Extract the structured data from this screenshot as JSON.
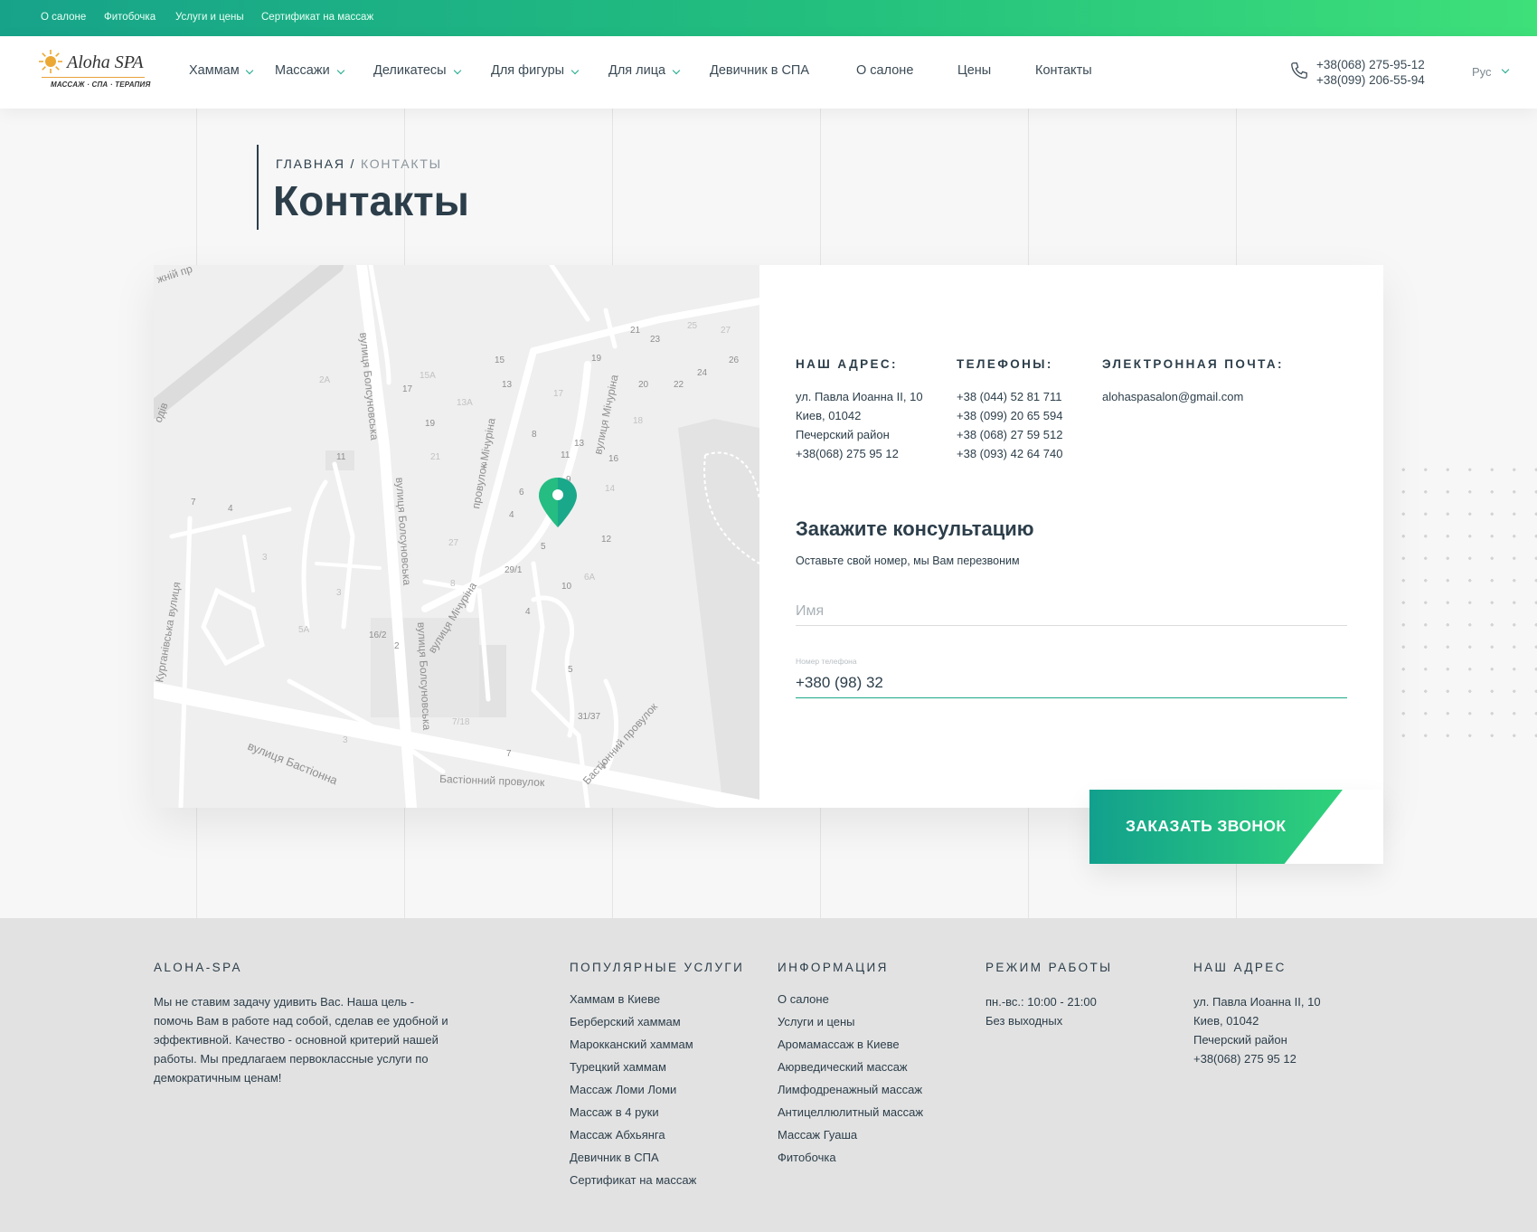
{
  "topbar": {
    "links": [
      "О салоне",
      "Фитобочка",
      "Услуги и цены",
      "Сертификат на массаж"
    ]
  },
  "brand": {
    "name": "Aloha SPA",
    "tagline": "МАССАЖ · СПА · ТЕРАПИЯ"
  },
  "nav": {
    "items": [
      {
        "label": "Хаммам",
        "dropdown": true
      },
      {
        "label": "Массажи",
        "dropdown": true
      },
      {
        "label": "Деликатесы",
        "dropdown": true
      },
      {
        "label": "Для фигуры",
        "dropdown": true
      },
      {
        "label": "Для лица",
        "dropdown": true
      },
      {
        "label": "Девичник в СПА",
        "dropdown": false
      },
      {
        "label": "О салоне",
        "dropdown": false
      },
      {
        "label": "Цены",
        "dropdown": false
      },
      {
        "label": "Контакты",
        "dropdown": false
      }
    ],
    "phones": [
      "+38(068) 275-95-12",
      "+38(099) 206-55-94"
    ],
    "language": "Рус"
  },
  "breadcrumb": {
    "home": "ГЛАВНАЯ",
    "separator": "/",
    "current": "КОНТАКТЫ"
  },
  "page_title": "Контакты",
  "map": {
    "streets": [
      "вулиця Болсуновська",
      "вулиця Болсуновська",
      "вулиця Болсуновська",
      "провулок Мічуріна",
      "вулиця Мічуріна",
      "вулиця Мічуріна",
      "Курганівська вулиця",
      "вулиця Бастіонна",
      "Бастіонний провулок",
      "Бастіонний провулок",
      "одів",
      "жній пр"
    ],
    "house_numbers": [
      "21",
      "23",
      "25",
      "27",
      "15",
      "19",
      "24",
      "26",
      "20",
      "22",
      "2А",
      "15А",
      "17",
      "13",
      "13А",
      "17",
      "18",
      "19",
      "8",
      "13",
      "11",
      "11",
      "21",
      "7",
      "16",
      "9",
      "14",
      "7",
      "4",
      "6",
      "4",
      "27",
      "5",
      "12",
      "3",
      "29/1",
      "8",
      "10",
      "6А",
      "3",
      "4",
      "5А",
      "16/2",
      "2",
      "5",
      "31/37",
      "7/18",
      "3",
      "7",
      "4"
    ]
  },
  "contacts": {
    "address": {
      "heading": "НАШ АДРЕС:",
      "lines": [
        "ул. Павла Иоанна II, 10",
        "Киев, 01042",
        "Печерский район",
        "+38(068) 275 95 12"
      ]
    },
    "phones": {
      "heading": "ТЕЛЕФОНЫ:",
      "lines": [
        "+38 (044) 52 81 711",
        "+38 (099) 20 65 594",
        "+38 (068) 27 59 512",
        "+38 (093) 42 64 740"
      ]
    },
    "email": {
      "heading": "ЭЛЕКТРОННАЯ ПОЧТА:",
      "lines": [
        "alohaspasalon@gmail.com"
      ]
    }
  },
  "consultation": {
    "title": "Закажите консультацию",
    "subtitle": "Оставьте свой номер, мы Вам перезвоним",
    "name_placeholder": "Имя",
    "phone_label": "Номер телефона",
    "phone_value": "+380 (98) 32",
    "button_label": "ЗАКАЗАТЬ ЗВОНОК"
  },
  "footer": {
    "about": {
      "heading": "ALOHA-SPA",
      "text": "Мы не ставим задачу удивить Вас. Наша цель - помочь Вам в работе над собой, сделав ее удобной и эффективной. Качество - основной критерий нашей работы. Мы предлагаем первоклассные услуги по демократичным ценам!"
    },
    "services": {
      "heading": "ПОПУЛЯРНЫЕ УСЛУГИ",
      "items": [
        "Хаммам в Киеве",
        "Берберский хаммам",
        "Марокканский хаммам",
        "Турецкий хаммам",
        "Массаж Ломи Ломи",
        "Массаж в 4 руки",
        "Массаж Абхьянга",
        "Девичник в СПА",
        "Сертификат на массаж"
      ]
    },
    "info": {
      "heading": "ИНФОРМАЦИЯ",
      "items": [
        "О салоне",
        "Услуги и цены",
        "Аромамассаж в Киеве",
        "Аюрведический массаж",
        "Лимфодренажный массаж",
        "Антицеллюлитный массаж",
        "Массаж Гуаша",
        "Фитобочка"
      ]
    },
    "hours": {
      "heading": "РЕЖИМ РАБОТЫ",
      "lines": [
        "пн.-вс.: 10:00 - 21:00",
        "Без выходных"
      ]
    },
    "address": {
      "heading": "НАШ АДРЕС",
      "lines": [
        "ул. Павла Иоанна II, 10",
        "Киев, 01042",
        "Печерский район",
        "+38(068) 275 95 12"
      ]
    }
  },
  "colors": {
    "accent": "#1aa88a",
    "accent_light": "#2fd27a",
    "text": "#2c3e4a",
    "footer_bg": "#e2e2e2"
  }
}
